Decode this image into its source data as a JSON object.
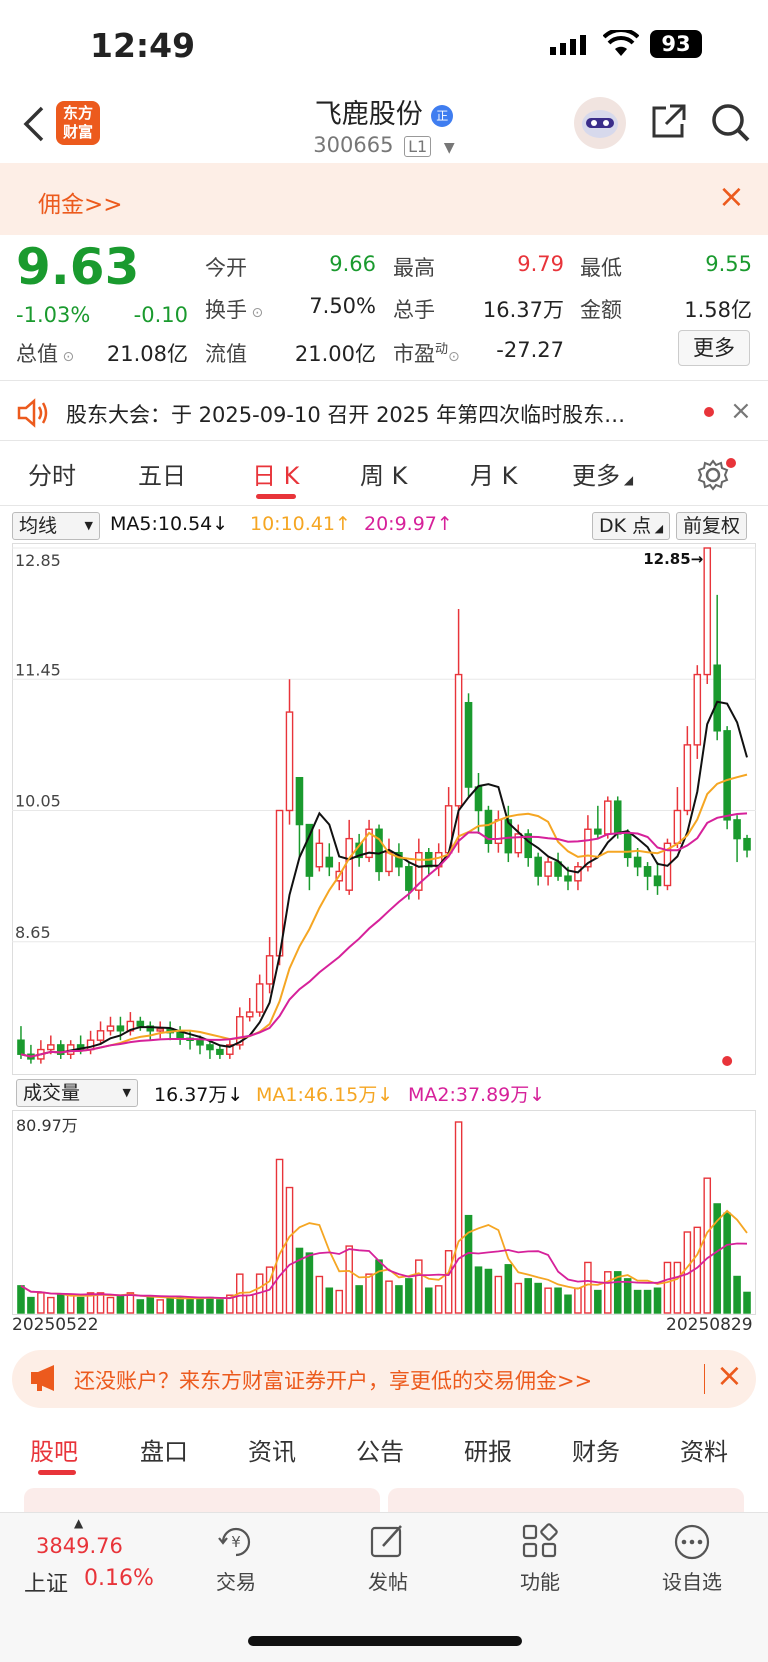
{
  "status": {
    "time": "12:49",
    "battery": "93"
  },
  "header": {
    "logo_text_1": "东方",
    "logo_text_2": "财富",
    "title": "飞鹿股份",
    "badge": "正",
    "code": "300665",
    "level": "L1"
  },
  "banner": {
    "text": "佣金>>",
    "close": "×"
  },
  "quote": {
    "price": "9.63",
    "change_pct": "-1.03%",
    "change": "-0.10",
    "open_label": "今开",
    "open": "9.66",
    "high_label": "最高",
    "high": "9.79",
    "low_label": "最低",
    "low": "9.55",
    "turnover_label": "换手",
    "turnover": "7.50%",
    "volume_label": "总手",
    "volume": "16.37万",
    "amount_label": "金额",
    "amount": "1.58亿",
    "mktcap_label": "总值",
    "mktcap": "21.08亿",
    "float_label": "流值",
    "float": "21.00亿",
    "pe_label": "市盈",
    "pe_sup": "动",
    "pe": "-27.27",
    "more": "更多"
  },
  "notice": {
    "text": "股东大会：于 2025-09-10 召开 2025 年第四次临时股东…"
  },
  "tabs": [
    "分时",
    "五日",
    "日 K",
    "周 K",
    "月 K",
    "更多"
  ],
  "kline_legend": {
    "selector": "均线",
    "ma5": "MA5:10.54",
    "ma10": "10:10.41",
    "ma20": "20:9.97",
    "dk": "DK 点",
    "fq": "前复权"
  },
  "price_axis": [
    "12.85",
    "11.45",
    "10.05",
    "8.65"
  ],
  "max_label": "12.85→",
  "vol_legend": {
    "selector": "成交量",
    "vol": "16.37万",
    "ma1": "MA1:46.15万",
    "ma2": "MA2:37.89万",
    "max": "80.97万"
  },
  "dates": {
    "start": "20250522",
    "end": "20250829"
  },
  "promo": {
    "text": "还没账户？来东方财富证券开户，享更低的交易佣金>>",
    "close": "×"
  },
  "bottom_tabs": [
    "股吧",
    "盘口",
    "资讯",
    "公告",
    "研报",
    "财务",
    "资料"
  ],
  "index": {
    "value": "3849.76",
    "name": "上证",
    "pct": "0.16%"
  },
  "nav": [
    "交易",
    "发帖",
    "功能",
    "设自选"
  ],
  "colors": {
    "up": "#e8343a",
    "down": "#1a9a2e",
    "accent": "#ec5a1d",
    "ma5": "#111111",
    "ma10": "#f5a623",
    "ma20": "#d6219a"
  },
  "chart_data": {
    "type": "candlestick",
    "ylim": [
      7.25,
      12.85
    ],
    "candles": [
      [
        7.6,
        7.45,
        7.75,
        7.4
      ],
      [
        7.45,
        7.4,
        7.55,
        7.35
      ],
      [
        7.4,
        7.5,
        7.6,
        7.35
      ],
      [
        7.5,
        7.55,
        7.65,
        7.45
      ],
      [
        7.55,
        7.45,
        7.6,
        7.4
      ],
      [
        7.45,
        7.55,
        7.6,
        7.4
      ],
      [
        7.55,
        7.5,
        7.65,
        7.45
      ],
      [
        7.5,
        7.6,
        7.7,
        7.45
      ],
      [
        7.6,
        7.7,
        7.8,
        7.55
      ],
      [
        7.7,
        7.75,
        7.85,
        7.65
      ],
      [
        7.75,
        7.7,
        7.85,
        7.6
      ],
      [
        7.7,
        7.8,
        7.9,
        7.65
      ],
      [
        7.8,
        7.75,
        7.85,
        7.7
      ],
      [
        7.75,
        7.7,
        7.8,
        7.6
      ],
      [
        7.7,
        7.72,
        7.8,
        7.62
      ],
      [
        7.72,
        7.68,
        7.8,
        7.6
      ],
      [
        7.68,
        7.62,
        7.75,
        7.55
      ],
      [
        7.62,
        7.6,
        7.7,
        7.5
      ],
      [
        7.6,
        7.55,
        7.65,
        7.45
      ],
      [
        7.55,
        7.5,
        7.6,
        7.4
      ],
      [
        7.5,
        7.45,
        7.55,
        7.4
      ],
      [
        7.45,
        7.55,
        7.6,
        7.4
      ],
      [
        7.55,
        7.85,
        7.95,
        7.5
      ],
      [
        7.85,
        7.9,
        8.05,
        7.8
      ],
      [
        7.9,
        8.2,
        8.3,
        7.85
      ],
      [
        8.2,
        8.5,
        8.7,
        8.1
      ],
      [
        8.5,
        10.05,
        10.05,
        8.4
      ],
      [
        10.05,
        11.1,
        11.45,
        9.9
      ],
      [
        10.4,
        9.9,
        10.35,
        9.55
      ],
      [
        9.9,
        9.35,
        9.85,
        9.2
      ],
      [
        9.45,
        9.7,
        9.85,
        9.4
      ],
      [
        9.55,
        9.45,
        9.7,
        9.35
      ],
      [
        9.3,
        9.4,
        9.5,
        9.2
      ],
      [
        9.2,
        9.75,
        9.95,
        9.15
      ],
      [
        9.7,
        9.55,
        9.8,
        9.45
      ],
      [
        9.55,
        9.85,
        9.95,
        9.5
      ],
      [
        9.85,
        9.4,
        9.9,
        9.3
      ],
      [
        9.4,
        9.6,
        9.75,
        9.35
      ],
      [
        9.6,
        9.45,
        9.7,
        9.35
      ],
      [
        9.45,
        9.2,
        9.5,
        9.1
      ],
      [
        9.2,
        9.6,
        9.75,
        9.1
      ],
      [
        9.6,
        9.45,
        9.65,
        9.35
      ],
      [
        9.45,
        9.6,
        9.7,
        9.35
      ],
      [
        9.6,
        10.1,
        10.3,
        9.55
      ],
      [
        10.1,
        11.5,
        12.2,
        9.6
      ],
      [
        11.2,
        10.3,
        11.3,
        10.2
      ],
      [
        10.3,
        10.05,
        10.45,
        9.8
      ],
      [
        10.05,
        9.7,
        10.1,
        9.6
      ],
      [
        9.7,
        9.95,
        10.05,
        9.6
      ],
      [
        9.95,
        9.6,
        10.1,
        9.5
      ],
      [
        9.6,
        9.8,
        9.9,
        9.55
      ],
      [
        9.8,
        9.55,
        9.85,
        9.45
      ],
      [
        9.55,
        9.35,
        9.6,
        9.25
      ],
      [
        9.35,
        9.5,
        9.55,
        9.25
      ],
      [
        9.5,
        9.35,
        9.6,
        9.3
      ],
      [
        9.35,
        9.3,
        9.45,
        9.2
      ],
      [
        9.3,
        9.45,
        9.5,
        9.2
      ],
      [
        9.45,
        9.85,
        10.0,
        9.4
      ],
      [
        9.85,
        9.8,
        10.1,
        9.75
      ],
      [
        9.8,
        10.15,
        10.2,
        9.75
      ],
      [
        10.15,
        9.8,
        10.2,
        9.75
      ],
      [
        9.8,
        9.55,
        9.85,
        9.45
      ],
      [
        9.55,
        9.45,
        9.65,
        9.35
      ],
      [
        9.45,
        9.35,
        9.5,
        9.2
      ],
      [
        9.35,
        9.25,
        9.5,
        9.15
      ],
      [
        9.25,
        9.7,
        9.75,
        9.2
      ],
      [
        9.7,
        10.05,
        10.3,
        9.65
      ],
      [
        10.05,
        10.75,
        10.95,
        10.0
      ],
      [
        10.75,
        11.5,
        11.6,
        10.6
      ],
      [
        11.5,
        12.85,
        12.85,
        11.4
      ],
      [
        11.6,
        10.9,
        12.35,
        10.8
      ],
      [
        10.9,
        9.95,
        10.95,
        9.85
      ],
      [
        9.95,
        9.75,
        10.0,
        9.5
      ],
      [
        9.75,
        9.63,
        9.79,
        9.55
      ]
    ]
  }
}
